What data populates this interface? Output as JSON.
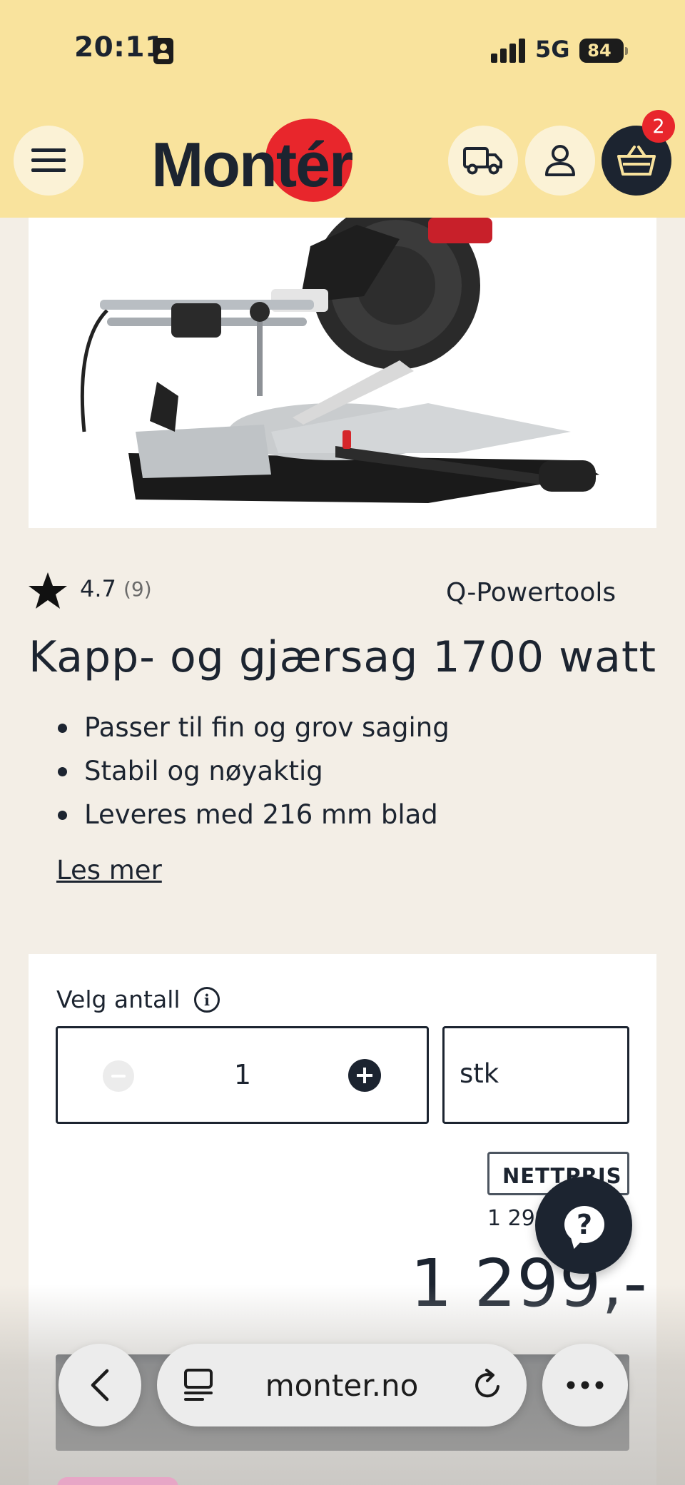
{
  "status_bar": {
    "time": "20:11",
    "network": "5G",
    "battery": "84"
  },
  "header": {
    "logo_text": "Montér",
    "cart_count": "2",
    "brand_color": "#e8262c",
    "background": "#f9e39d"
  },
  "product": {
    "rating": "4.7",
    "review_count": "(9)",
    "brand": "Q-Powertools",
    "title": "Kapp- og gjærsag 1700 watt",
    "features": [
      "Passer til fin og grov saging",
      "Stabil og nøyaktig",
      "Leveres med 216 mm blad"
    ],
    "read_more": "Les mer"
  },
  "purchase": {
    "quantity_label": "Velg antall",
    "quantity": "1",
    "unit": "stk",
    "price_badge": "NETTPRIS",
    "old_price": "1 299",
    "price": "1 299,-"
  },
  "browser": {
    "url": "monter.no"
  },
  "icons": [
    "menu-icon",
    "truck-icon",
    "user-icon",
    "basket-icon",
    "star-icon",
    "info-icon",
    "minus-icon",
    "plus-icon",
    "question-icon",
    "back-icon",
    "tabs-icon",
    "reload-icon",
    "more-icon"
  ]
}
